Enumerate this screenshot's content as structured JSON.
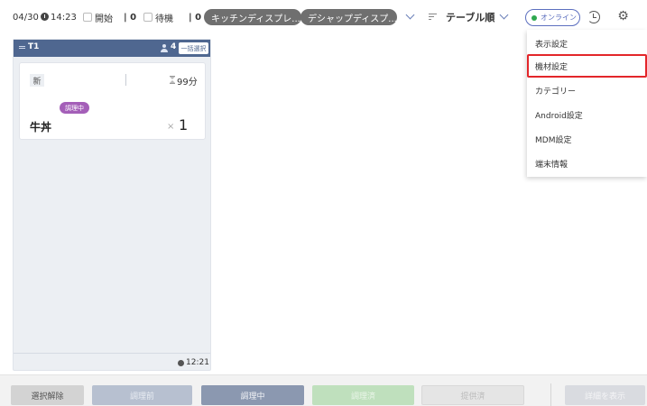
{
  "topbar": {
    "date": "04/30",
    "time": "14:23",
    "start_label": "開始",
    "start_count": "| 0",
    "wait_label": "待機",
    "wait_count": "| 0",
    "display_chips": [
      "キッチンディスプレ...",
      "デシャップディスプ..."
    ],
    "sort_label": "テーブル順",
    "status_label": "オンライン",
    "status_color": "#2fa84f"
  },
  "column": {
    "table_name": "T1",
    "guest_count": "4",
    "bulk_select_label": "一括選択",
    "footer_time": "12:21",
    "header_color": "#4f6790"
  },
  "ticket": {
    "new_label": "新",
    "elapsed": "99分",
    "status_badge": "調理中",
    "items": [
      {
        "name": "牛丼",
        "times": "×",
        "quantity": "1"
      }
    ]
  },
  "menu": {
    "items": [
      "表示設定",
      "機材設定",
      "カテゴリー",
      "Android設定",
      "MDM設定",
      "端末情報"
    ],
    "highlighted_index": 1,
    "highlight_color": "#e3262a"
  },
  "actions": {
    "deselect": "選択解除",
    "before_cooking": "調理前",
    "cooking": "調理中",
    "cooked": "調理済",
    "served": "提供済",
    "show_details": "詳細を表示"
  }
}
